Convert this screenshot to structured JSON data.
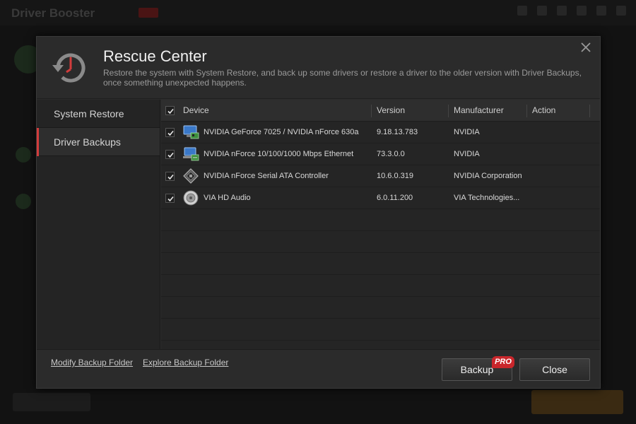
{
  "background_app": {
    "title": "Driver Booster"
  },
  "dialog": {
    "title": "Rescue Center",
    "description": "Restore the system with System Restore, and back up some drivers or restore a driver to the older version with Driver Backups, once something unexpected happens.",
    "close_icon": "close-icon",
    "header_icon": "history-restore-icon"
  },
  "sidebar": {
    "items": [
      {
        "label": "System Restore",
        "active": false
      },
      {
        "label": "Driver Backups",
        "active": true
      }
    ],
    "accent_color": "#d23c3c"
  },
  "table": {
    "header_checked": true,
    "columns": {
      "device": "Device",
      "version": "Version",
      "manufacturer": "Manufacturer",
      "action": "Action"
    },
    "rows": [
      {
        "checked": true,
        "icon": "display-adapter-icon",
        "device": "NVIDIA GeForce 7025 / NVIDIA nForce 630a",
        "version": "9.18.13.783",
        "manufacturer": "NVIDIA",
        "action": ""
      },
      {
        "checked": true,
        "icon": "network-adapter-icon",
        "device": "NVIDIA nForce 10/100/1000 Mbps Ethernet",
        "version": "73.3.0.0",
        "manufacturer": "NVIDIA",
        "action": ""
      },
      {
        "checked": true,
        "icon": "storage-controller-icon",
        "device": "NVIDIA nForce Serial ATA Controller",
        "version": "10.6.0.319",
        "manufacturer": "NVIDIA Corporation",
        "action": ""
      },
      {
        "checked": true,
        "icon": "audio-speaker-icon",
        "device": "VIA HD Audio",
        "version": "6.0.11.200",
        "manufacturer": "VIA Technologies...",
        "action": ""
      }
    ]
  },
  "footer": {
    "modify_link": "Modify Backup Folder",
    "explore_link": "Explore Backup Folder",
    "backup_button": "Backup",
    "pro_badge": "PRO",
    "close_button": "Close"
  }
}
